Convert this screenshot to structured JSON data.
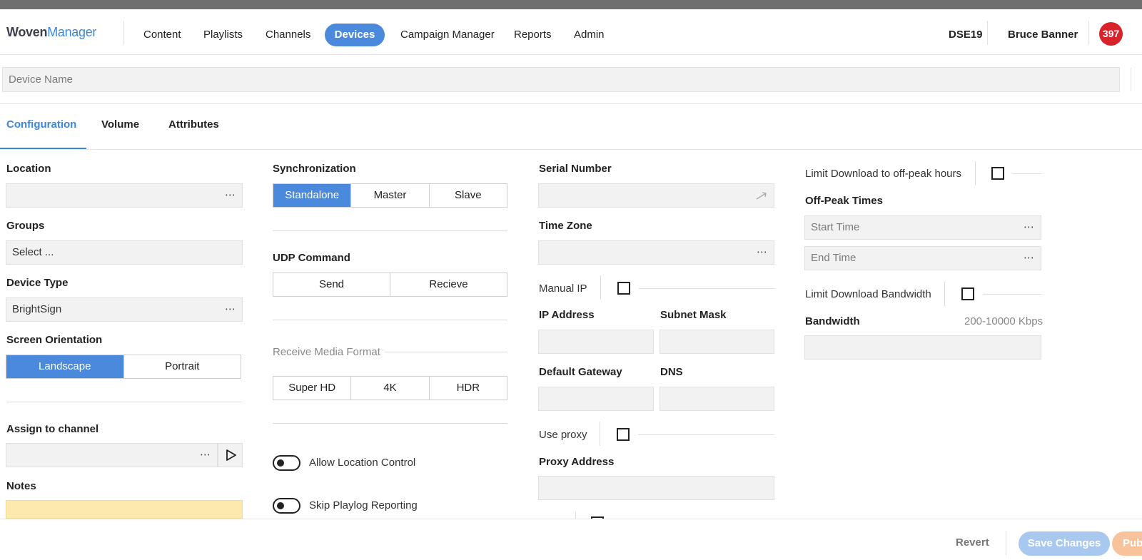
{
  "app": {
    "logo_part1": "Woven",
    "logo_part2": "Manager"
  },
  "nav": {
    "items": [
      "Content",
      "Playlists",
      "Channels",
      "Devices",
      "Campaign Manager",
      "Reports",
      "Admin"
    ],
    "active": "Devices",
    "org": "DSE19",
    "user": "Bruce Banner",
    "notifications": "397"
  },
  "device_name": {
    "placeholder": "Device Name"
  },
  "tabs": [
    "Configuration",
    "Volume",
    "Attributes"
  ],
  "col1": {
    "location_label": "Location",
    "groups_label": "Groups",
    "groups_placeholder": "Select ...",
    "device_type_label": "Device Type",
    "device_type_value": "BrightSign",
    "orientation_label": "Screen Orientation",
    "orientation_options": [
      "Landscape",
      "Portrait"
    ],
    "orientation_selected": "Landscape",
    "assign_label": "Assign to channel",
    "notes_label": "Notes"
  },
  "col2": {
    "sync_label": "Synchronization",
    "sync_options": [
      "Standalone",
      "Master",
      "Slave"
    ],
    "sync_selected": "Standalone",
    "udp_label": "UDP Command",
    "udp_options": [
      "Send",
      "Recieve"
    ],
    "media_label": "Receive Media Format",
    "media_options": [
      "Super HD",
      "4K",
      "HDR"
    ],
    "toggle1_label": "Allow Location Control",
    "toggle2_label": "Skip Playlog Reporting"
  },
  "col3": {
    "serial_label": "Serial Number",
    "timezone_label": "Time Zone",
    "manual_ip_label": "Manual IP",
    "ip_label": "IP Address",
    "subnet_label": "Subnet Mask",
    "gateway_label": "Default Gateway",
    "dns_label": "DNS",
    "proxy_label": "Use proxy",
    "proxy_address_label": "Proxy Address"
  },
  "col4": {
    "limit_offpeak_label": "Limit Download to off-peak hours",
    "offpeak_label": "Off-Peak Times",
    "start_placeholder": "Start Time",
    "end_placeholder": "End Time",
    "limit_bw_label": "Limit Download Bandwidth",
    "bandwidth_label": "Bandwidth",
    "bandwidth_hint": "200-10000 Kbps"
  },
  "footer": {
    "revert": "Revert",
    "save": "Save Changes",
    "publish": "Pub"
  },
  "colors": {
    "accent": "#4a89dc",
    "badge": "#d8232a",
    "notes_bg": "#fde9ae",
    "publish": "#f8c39a"
  }
}
